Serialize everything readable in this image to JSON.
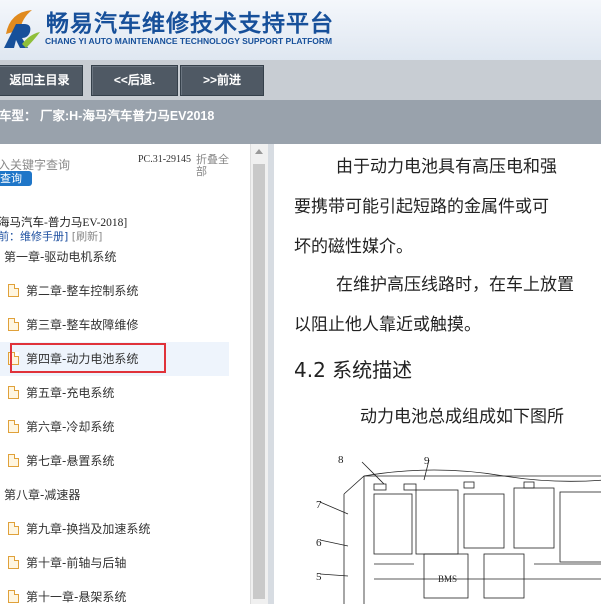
{
  "header": {
    "title": "畅易汽车维修技术支持平台",
    "subtitle": "CHANG YI AUTO MAINTENANCE TECHNOLOGY SUPPORT PLATFORM",
    "logo_icon": "cy-logo-icon",
    "brand_color": "#17509a"
  },
  "nav": {
    "home": "返回主目录",
    "back": "<<后退.",
    "forward": ">>前进"
  },
  "vehicle": {
    "text": "车型： 厂家:H-海马汽车普力马EV2018"
  },
  "sidebar": {
    "search_placeholder": "入关键字查询",
    "search_button": "查询",
    "pc_code": "PC.31-29145",
    "collapse_all": "折叠全部",
    "tree_root": "海马汽车-普力马EV-2018]",
    "current_label": "前：维修手册]",
    "refresh": "[刷新]",
    "items": [
      {
        "label": "第一章-驱动电机系统",
        "type": "folder"
      },
      {
        "label": "第二章-整车控制系统",
        "type": "doc"
      },
      {
        "label": "第三章-整车故障维修",
        "type": "doc"
      },
      {
        "label": "第四章-动力电池系统",
        "type": "doc"
      },
      {
        "label": "第五章-充电系统",
        "type": "doc"
      },
      {
        "label": "第六章-冷却系统",
        "type": "doc"
      },
      {
        "label": "第七章-悬置系统",
        "type": "doc"
      },
      {
        "label": "第八章-减速器",
        "type": "folder"
      },
      {
        "label": "第九章-换挡及加速系统",
        "type": "doc"
      },
      {
        "label": "第十章-前轴与后轴",
        "type": "doc"
      },
      {
        "label": "第十一章-悬架系统",
        "type": "doc"
      }
    ],
    "selected_index": 3,
    "highlight_color": "#e0323a"
  },
  "content": {
    "lines": [
      "由于动力电池具有高压电和强",
      "要携带可能引起短路的金属件或可",
      "坏的磁性媒介。",
      "在维护高压线路时，在车上放置",
      "以阻止他人靠近或触摸。"
    ],
    "section_heading": "4.2 系统描述",
    "intro_line": "动力电池总成组成如下图所",
    "diagram_labels": [
      "8",
      "9",
      "7",
      "6",
      "5",
      "BMS"
    ]
  }
}
